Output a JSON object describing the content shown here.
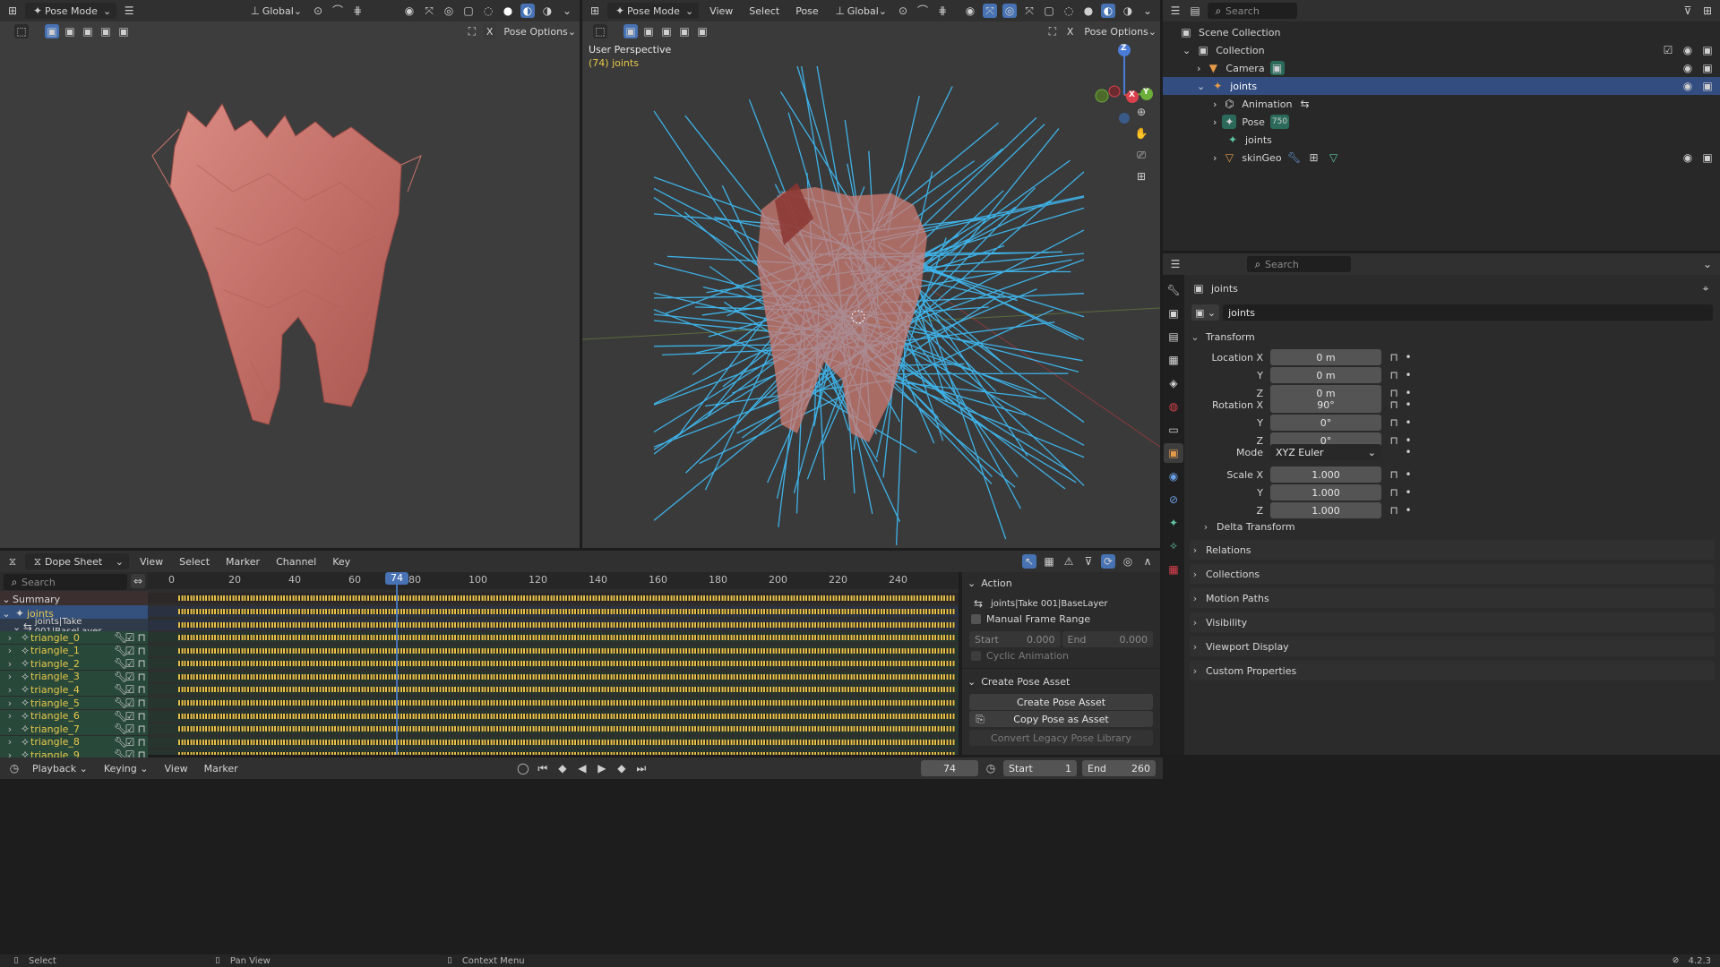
{
  "viewport_left": {
    "mode_label": "Pose Mode",
    "orientation_label": "Global",
    "pose_options_label": "Pose Options",
    "x_label": "X"
  },
  "viewport_right": {
    "mode_label": "Pose Mode",
    "menus": [
      "View",
      "Select",
      "Pose"
    ],
    "orientation_label": "Global",
    "pose_options_label": "Pose Options",
    "x_label": "X",
    "overlay_title": "User Perspective",
    "overlay_subtitle": "(74) joints",
    "gizmo_axes": {
      "x": "X",
      "y": "Y",
      "z": "Z"
    }
  },
  "outliner": {
    "search_placeholder": "Search",
    "items": [
      {
        "label": "Scene Collection"
      },
      {
        "label": "Collection"
      },
      {
        "label": "Camera"
      },
      {
        "label": "joints"
      },
      {
        "label": "Animation"
      },
      {
        "label": "Pose",
        "badge": "750"
      },
      {
        "label": "joints"
      },
      {
        "label": "skinGeo"
      }
    ]
  },
  "properties": {
    "search_placeholder": "Search",
    "object_name": "joints",
    "object_field": "joints",
    "transform_label": "Transform",
    "location_label": "Location X",
    "location": [
      "0 m",
      "0 m",
      "0 m"
    ],
    "rotation_label": "Rotation X",
    "rotation": [
      "90°",
      "0°",
      "0°"
    ],
    "mode_label": "Mode",
    "mode_value": "XYZ Euler",
    "scale_label": "Scale X",
    "scale": [
      "1.000",
      "1.000",
      "1.000"
    ],
    "axis_y": "Y",
    "axis_z": "Z",
    "delta_transform": "Delta Transform",
    "sections": [
      "Relations",
      "Collections",
      "Motion Paths",
      "Visibility",
      "Viewport Display",
      "Custom Properties"
    ]
  },
  "dopesheet": {
    "editor_label": "Dope Sheet",
    "menus": [
      "View",
      "Select",
      "Marker",
      "Channel",
      "Key"
    ],
    "search_placeholder": "Search",
    "ruler_ticks": [
      "0",
      "20",
      "40",
      "60",
      "80",
      "100",
      "120",
      "140",
      "160",
      "180",
      "200",
      "220",
      "240"
    ],
    "current_frame": "74",
    "summary_label": "Summary",
    "object_label": "joints",
    "action_label": "joints|Take 001|BaseLayer",
    "channels": [
      "triangle_0",
      "triangle_1",
      "triangle_2",
      "triangle_3",
      "triangle_4",
      "triangle_5",
      "triangle_6",
      "triangle_7",
      "triangle_8",
      "triangle_9"
    ]
  },
  "action_panel": {
    "action_header": "Action",
    "action_name": "joints|Take 001|BaseLayer",
    "manual_frame_range": "Manual Frame Range",
    "start_label": "Start",
    "start_value": "0.000",
    "end_label": "End",
    "end_value": "0.000",
    "cyclic_label": "Cyclic Animation",
    "create_pose_header": "Create Pose Asset",
    "create_pose_btn": "Create Pose Asset",
    "copy_pose_btn": "Copy Pose as Asset",
    "convert_btn": "Convert Legacy Pose Library"
  },
  "timeline": {
    "menus": [
      "Playback",
      "Keying",
      "View",
      "Marker"
    ],
    "frame": "74",
    "start_label": "Start",
    "start_value": "1",
    "end_label": "End",
    "end_value": "260"
  },
  "statusbar": {
    "select": "Select",
    "pan_view": "Pan View",
    "context_menu": "Context Menu",
    "version": "4.2.3"
  },
  "colors": {
    "accent": "#4772b3",
    "keyframe": "#e8c24a",
    "bones": "#3fb8f0",
    "playhead": "#4772b3"
  }
}
